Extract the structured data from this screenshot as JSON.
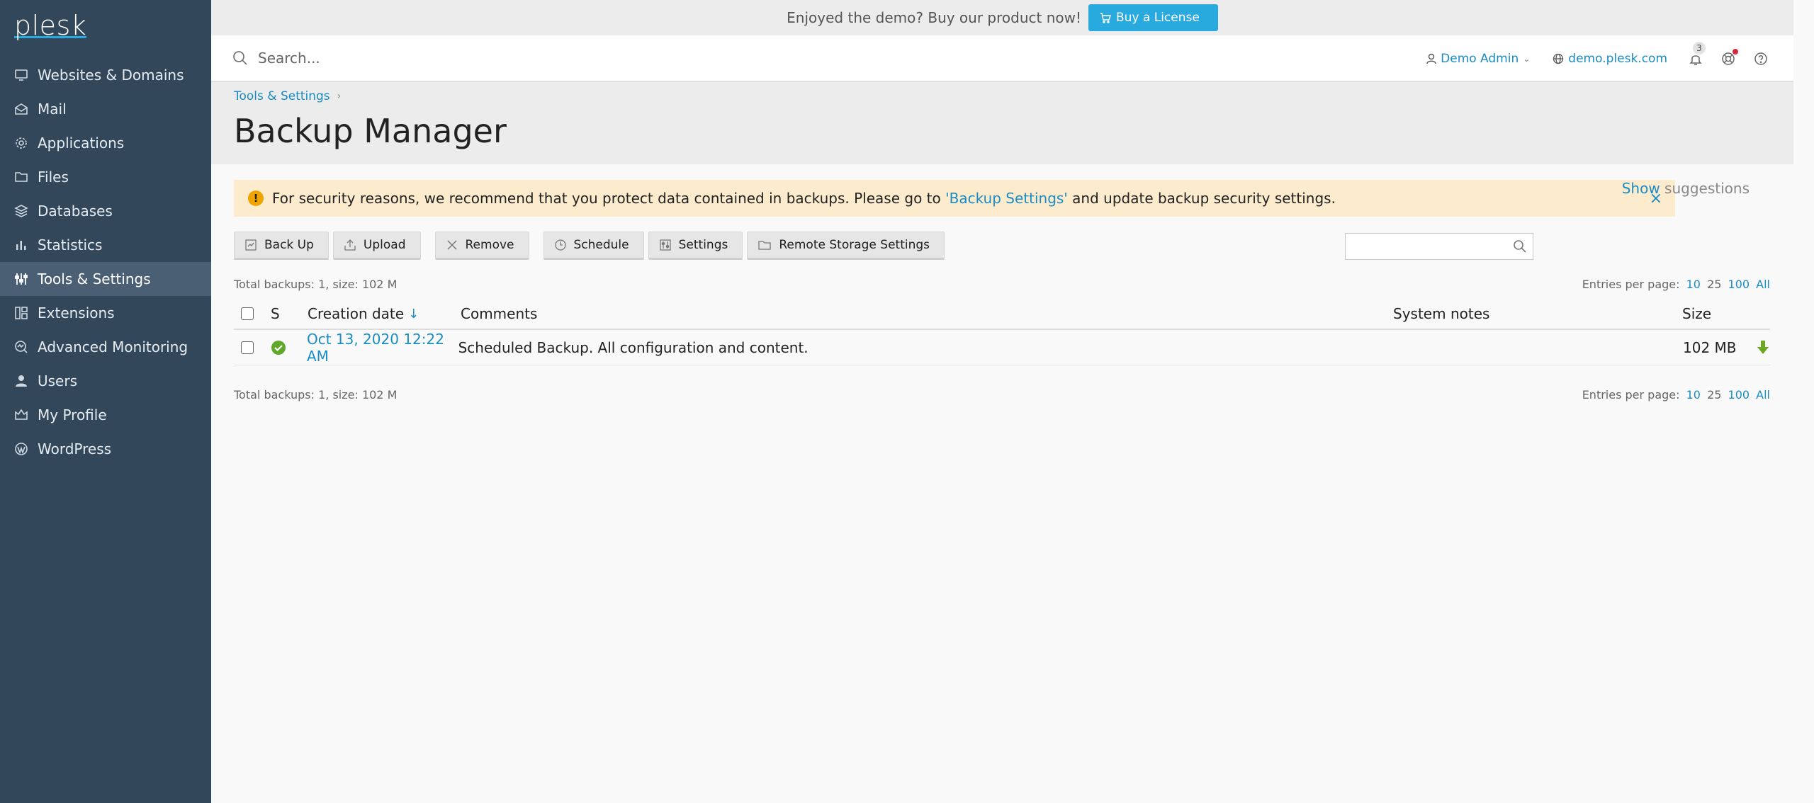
{
  "sidebar": {
    "logo": "plesk",
    "items": [
      {
        "label": "Websites & Domains",
        "icon": "monitor-icon"
      },
      {
        "label": "Mail",
        "icon": "mail-icon"
      },
      {
        "label": "Applications",
        "icon": "gear-icon"
      },
      {
        "label": "Files",
        "icon": "folder-icon"
      },
      {
        "label": "Databases",
        "icon": "database-icon"
      },
      {
        "label": "Statistics",
        "icon": "bar-chart-icon"
      },
      {
        "label": "Tools & Settings",
        "icon": "sliders-icon",
        "active": true
      },
      {
        "label": "Extensions",
        "icon": "extensions-icon"
      },
      {
        "label": "Advanced Monitoring",
        "icon": "monitoring-icon"
      },
      {
        "label": "Users",
        "icon": "user-icon"
      },
      {
        "label": "My Profile",
        "icon": "profile-icon"
      },
      {
        "label": "WordPress",
        "icon": "wordpress-icon"
      }
    ]
  },
  "promo": {
    "text": "Enjoyed the demo? Buy our product now!",
    "button": "Buy a License"
  },
  "header": {
    "search_placeholder": "Search...",
    "user": "Demo Admin",
    "domain": "demo.plesk.com",
    "notifications_count": "3"
  },
  "breadcrumb": {
    "item": "Tools & Settings"
  },
  "page_title": "Backup Manager",
  "alert": {
    "before": "For security reasons, we recommend that you protect data contained in backups. Please go to ",
    "link": "'Backup Settings'",
    "after": " and update backup security settings.",
    "close": "×"
  },
  "suggestions": {
    "show": "Show",
    "rest": " suggestions"
  },
  "toolbar": {
    "backup": "Back Up",
    "upload": "Upload",
    "remove": "Remove",
    "schedule": "Schedule",
    "settings": "Settings",
    "remote": "Remote Storage Settings"
  },
  "summary": "Total backups: 1, size: 102 M",
  "entries": {
    "label": "Entries per page:",
    "opts": [
      "10",
      "25",
      "100",
      "All"
    ]
  },
  "table": {
    "headers": {
      "s": "S",
      "date": "Creation date",
      "comments": "Comments",
      "notes": "System notes",
      "size": "Size"
    },
    "sort_arrow": "↓",
    "rows": [
      {
        "date": "Oct 13, 2020 12:22 AM",
        "comment": "Scheduled Backup. All configuration and content.",
        "notes": "",
        "size": "102 MB"
      }
    ]
  },
  "colors": {
    "sidebar": "#33475b",
    "accent": "#28aade",
    "link": "#1a8cc4",
    "alert": "#fdebcd"
  }
}
